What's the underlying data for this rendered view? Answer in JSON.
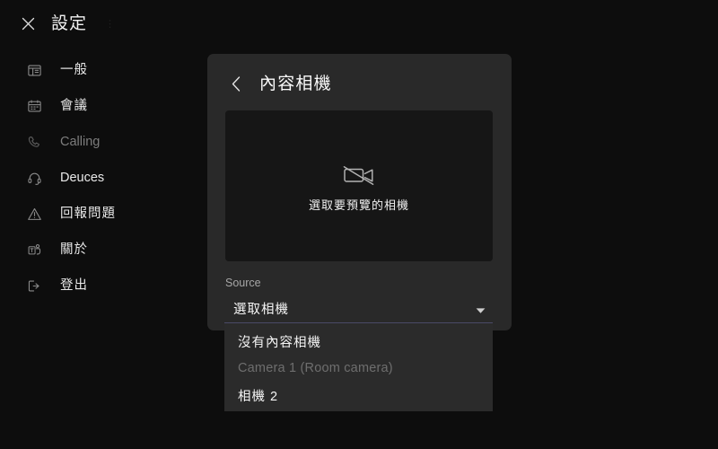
{
  "window": {
    "title": "設定",
    "close_icon": "close-icon",
    "titlebar_dots": "⋮"
  },
  "sidebar": {
    "items": [
      {
        "label": "一般",
        "icon": "general-icon",
        "dimmed": false,
        "cjk": true
      },
      {
        "label": "會議",
        "icon": "calendar-icon",
        "dimmed": false,
        "cjk": true
      },
      {
        "label": "Calling",
        "icon": "phone-icon",
        "dimmed": true,
        "cjk": false
      },
      {
        "label": "Deuces",
        "icon": "headset-icon",
        "dimmed": false,
        "cjk": false
      },
      {
        "label": "回報問題",
        "icon": "warning-icon",
        "dimmed": false,
        "cjk": true
      },
      {
        "label": "關於",
        "icon": "teams-logo-icon",
        "dimmed": false,
        "cjk": true
      },
      {
        "label": "登出",
        "icon": "sign-out-icon",
        "dimmed": false,
        "cjk": true
      }
    ]
  },
  "panel": {
    "back_icon": "chevron-left-icon",
    "title": "內容相機",
    "preview": {
      "icon": "camera-off-icon",
      "hint": "選取要預覽的相機"
    },
    "source": {
      "label": "Source",
      "value": "選取相機",
      "caret_icon": "chevron-down-icon",
      "options": [
        {
          "label": "沒有內容相機",
          "disabled": false,
          "cjk": true
        },
        {
          "label": "Camera 1 (Room camera)",
          "disabled": true,
          "cjk": false
        },
        {
          "label": "相機 2",
          "disabled": false,
          "cjk": true
        }
      ]
    }
  },
  "colors": {
    "app_background": "#0d0d0d",
    "panel_background": "#292929",
    "preview_background": "#161616",
    "dropdown_background": "#2b2b2b",
    "dropdown_accent_border": "#4a4a66",
    "text_primary": "#f5f5f5",
    "text_secondary": "#a6a6a6",
    "text_disabled": "#6e6e6e"
  }
}
